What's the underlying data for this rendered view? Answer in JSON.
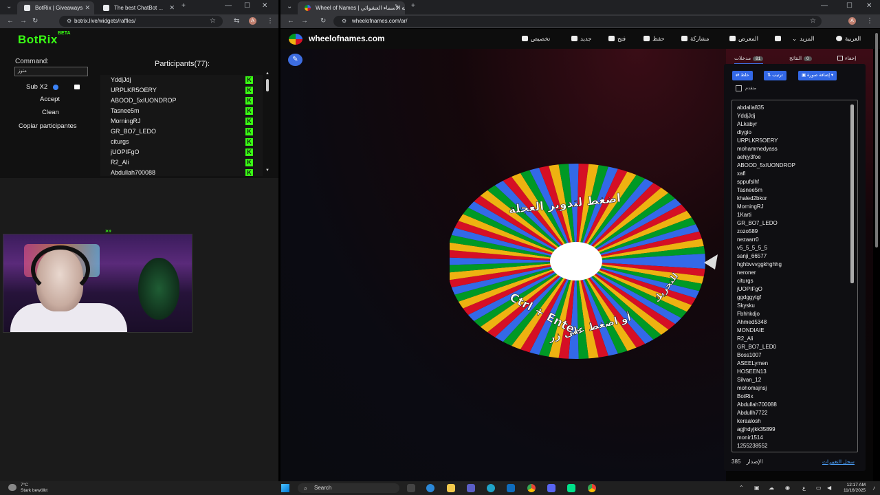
{
  "left_browser": {
    "tabs": [
      {
        "title": "BotRix | Giveaways"
      },
      {
        "title": "The best ChatBot ..."
      }
    ],
    "url": "botrix.live/widgets/raffles/"
  },
  "botrix": {
    "logo": "BotRix",
    "beta": "BETA",
    "command_label": "Command:",
    "command_value": "متوز",
    "sub_label": "Sub X2",
    "accept_label": "Accept",
    "clean_label": "Clean",
    "copy_label": "Copiar participantes",
    "participants_title": "Participants(77):",
    "participants": [
      "YddjJdj",
      "URPLKR5OERY",
      "ABOOD_5xIUONDROP",
      "Tasnee5m",
      "MorningRJ",
      "GR_BO7_LEDO",
      "citurgs",
      "jUOPIFgO",
      "R2_Ali",
      "Abdullah700088"
    ],
    "kick_glyph": "K"
  },
  "webcam": {
    "arrows": "»»"
  },
  "right_browser": {
    "tab_title": "Wheel of Names | عجلة الأسماء العشوائي",
    "url": "wheelofnames.com/ar/"
  },
  "wheel_site": {
    "site_name": "wheelofnames.com",
    "menu": [
      "تخصيص",
      "جديد",
      "فتح",
      "حفظ",
      "مشاركة",
      "المعرض",
      "",
      "المزيد",
      "العربية"
    ],
    "wheel_text_top": "اضغط لتدوير العجلة",
    "wheel_text_bottom_ar": "أو اضغط على زر",
    "wheel_text_shortcut": "Ctrl + Enter",
    "wheel_text_right": "للتحريك",
    "wheel_colors": [
      "#3369e8",
      "#d50f25",
      "#eeb211",
      "#009925"
    ],
    "panel_tabs": {
      "entries_label": "مدخلات",
      "entries_count": "81",
      "results_label": "النتائج",
      "results_count": "0",
      "hide_label": "إخفاء"
    },
    "buttons": {
      "shuffle": "خلط",
      "sort": "ترتيب",
      "add_image": "إضافة صورة"
    },
    "advanced_label": "متقدم",
    "entries": [
      "abdalla835",
      "YddjJdj",
      "ALkabyr",
      "diygio",
      "URPLKR5OERY",
      "mohammedyass",
      "aehjy3foe",
      "ABOOD_5xIUONDROP",
      "xafl",
      "sppufslhf",
      "Tasnee5m",
      "khaled2bkor",
      "MorningRJ",
      "1Karti",
      "GR_BO7_LEDO",
      "zozo589",
      "nezaarr0",
      "v5_5_5_5_5",
      "sanji_66577",
      "hghbvvvggkhghhg",
      "neroner",
      "citurgs",
      "jUOPIFgO",
      "ggdggytgf",
      "Skysku",
      "Fbhhkdjo",
      "Ahmed5348",
      "MONDIAIE",
      "R2_Ali",
      "GR_BO7_LED0",
      "Boss1007",
      "ASEELymen",
      "HOSEEN13",
      "Silvan_12",
      "mohomajnsj",
      "BotRix",
      "Abdullah700088",
      "Abdullh7722",
      "keraalosh",
      "agjhdyjkk35899",
      "monir1514",
      "1255238552"
    ],
    "version_label": "الإصدار",
    "version_number": "385",
    "changelog_label": "سجل التغييرات"
  },
  "taskbar": {
    "weather_temp": "7°C",
    "weather_desc": "Stark bewölkt",
    "search_label": "Search",
    "time": "12:17 AM",
    "date": "11/16/2025",
    "lang": "ع"
  }
}
